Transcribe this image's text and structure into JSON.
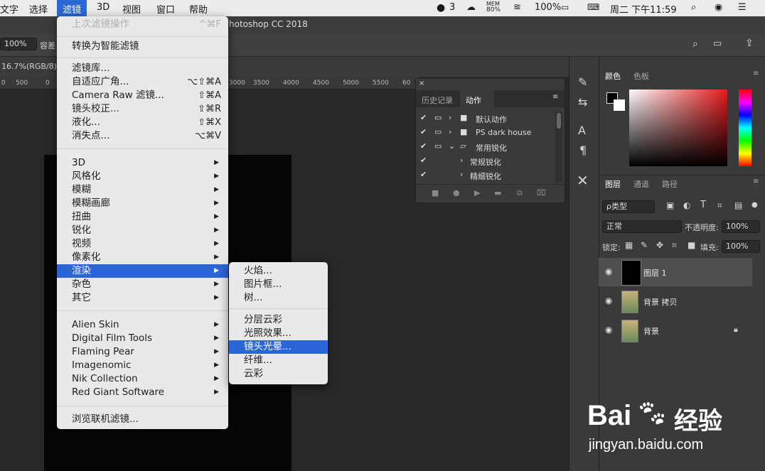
{
  "menubar": {
    "items": [
      "文字",
      "选择",
      "滤镜",
      "3D",
      "视图",
      "窗口",
      "帮助"
    ],
    "status": {
      "qq_count": "3",
      "mem_label": "MEM",
      "mem_value": "80%",
      "battery": "100%",
      "datetime": "周二 下午11:59"
    }
  },
  "window": {
    "title": "hotoshop CC 2018"
  },
  "options": {
    "zoom": "100%",
    "tolerance_label": "容差"
  },
  "doc": {
    "info": "16.7%(RGB/8)"
  },
  "ruler": {
    "ticks": [
      "0",
      "500",
      "0",
      "3000",
      "3500",
      "4000",
      "4500",
      "5000",
      "5500",
      "60"
    ]
  },
  "filter_menu": {
    "last_filter": "上次滤镜操作",
    "last_filter_shortcut": "^⌘F",
    "smart": "转换为智能滤镜",
    "group1": [
      {
        "label": "滤镜库...",
        "shortcut": ""
      },
      {
        "label": "自适应广角...",
        "shortcut": "⌥⇧⌘A"
      },
      {
        "label": "Camera Raw 滤镜...",
        "shortcut": "⇧⌘A"
      },
      {
        "label": "镜头校正...",
        "shortcut": "⇧⌘R"
      },
      {
        "label": "液化...",
        "shortcut": "⇧⌘X"
      },
      {
        "label": "消失点...",
        "shortcut": "⌥⌘V"
      }
    ],
    "group2": [
      "3D",
      "风格化",
      "模糊",
      "模糊画廊",
      "扭曲",
      "锐化",
      "视频",
      "像素化",
      "渲染",
      "杂色",
      "其它"
    ],
    "group3": [
      "Alien Skin",
      "Digital Film Tools",
      "Flaming Pear",
      "Imagenomic",
      "Nik Collection",
      "Red Giant Software"
    ],
    "browse": "浏览联机滤镜..."
  },
  "render_submenu": {
    "group1": [
      "火焰...",
      "图片框...",
      "树..."
    ],
    "group2": [
      "分层云彩",
      "光照效果...",
      "镜头光晕...",
      "纤维...",
      "云彩"
    ]
  },
  "actions_panel": {
    "tabs": [
      "历史记录",
      "动作"
    ],
    "rows": [
      "默认动作",
      "PS dark house",
      "常用锐化",
      "常规锐化",
      "精细锐化"
    ]
  },
  "color_panel": {
    "tabs": [
      "颜色",
      "色板"
    ]
  },
  "layers_panel": {
    "tabs": [
      "图层",
      "通道",
      "路径"
    ],
    "filter": "ρ类型",
    "blend": "正常",
    "opacity_label": "不透明度:",
    "opacity": "100%",
    "lock_label": "锁定:",
    "fill_label": "填充:",
    "fill": "100%",
    "layers": [
      "图层 1",
      "背景 拷贝",
      "背景"
    ]
  },
  "watermark": {
    "brand": "Bai",
    "brand2": "经验",
    "url": "jingyan.baidu.com"
  },
  "colors": {
    "accent": "#2b66d9",
    "menu_bg": "#e9e9e9",
    "panel_bg": "#3a3a3a"
  }
}
